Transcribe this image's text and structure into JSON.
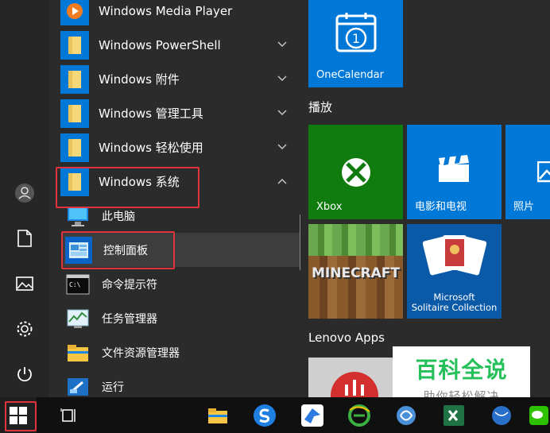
{
  "apps": {
    "media_player": "Windows Media Player",
    "powershell": "Windows PowerShell",
    "accessories": "Windows 附件",
    "admin_tools": "Windows 管理工具",
    "ease_of_access": "Windows 轻松使用",
    "system": "Windows 系统"
  },
  "system_items": {
    "this_pc": "此电脑",
    "control_panel": "控制面板",
    "cmd": "命令提示符",
    "task_manager": "任务管理器",
    "explorer": "文件资源管理器",
    "run": "运行"
  },
  "tiles": {
    "onecalendar": "OneCalendar",
    "onecalendar_glyph": "1",
    "group_play": "播放",
    "xbox": "Xbox",
    "movies": "电影和电视",
    "photos": "照片",
    "minecraft": "MINECRAFT",
    "solitaire_line1": "Microsoft",
    "solitaire_line2": "Solitaire Collection",
    "group_lenovo": "Lenovo Apps"
  },
  "watermark": {
    "title": "百科全说",
    "subtitle": "助你轻松解决"
  },
  "colors": {
    "accent": "#0078d7",
    "xbox_green": "#107c10",
    "highlight_red": "#e0333c"
  }
}
